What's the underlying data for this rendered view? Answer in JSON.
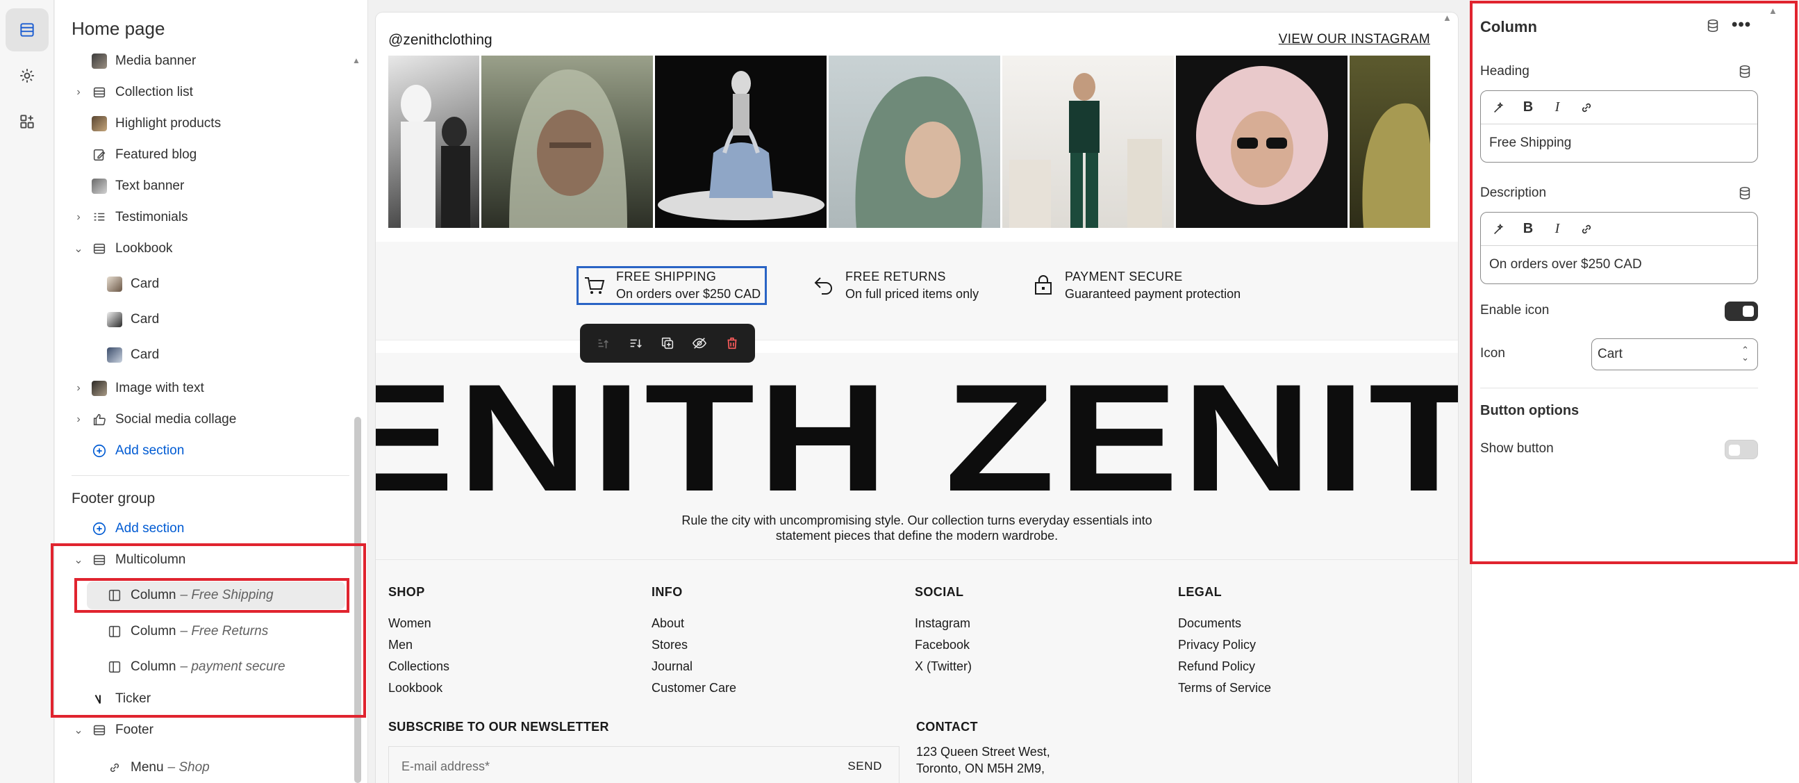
{
  "sidebar": {
    "title": "Home page",
    "items": [
      {
        "label": "Media banner",
        "subtitle": ""
      },
      {
        "label": "Collection list",
        "subtitle": ""
      },
      {
        "label": "Highlight products",
        "subtitle": ""
      },
      {
        "label": "Featured blog",
        "subtitle": ""
      },
      {
        "label": "Text banner",
        "subtitle": ""
      },
      {
        "label": "Testimonials",
        "subtitle": ""
      },
      {
        "label": "Lookbook",
        "subtitle": ""
      },
      {
        "label": "Card",
        "subtitle": ""
      },
      {
        "label": "Card",
        "subtitle": ""
      },
      {
        "label": "Card",
        "subtitle": ""
      },
      {
        "label": "Image with text",
        "subtitle": ""
      },
      {
        "label": "Social media collage",
        "subtitle": ""
      }
    ],
    "add_section_label": "Add section",
    "footer_group_label": "Footer group",
    "footer_items": [
      {
        "label": "Multicolumn",
        "subtitle": ""
      },
      {
        "label": "Column",
        "subtitle": "– Free Shipping"
      },
      {
        "label": "Column",
        "subtitle": "– Free Returns"
      },
      {
        "label": "Column",
        "subtitle": "– payment secure"
      },
      {
        "label": "Ticker",
        "subtitle": ""
      },
      {
        "label": "Footer",
        "subtitle": ""
      },
      {
        "label": "Menu",
        "subtitle": "– Shop"
      }
    ]
  },
  "preview": {
    "instagram_handle": "@zenithclothing",
    "instagram_link": "VIEW OUR INSTAGRAM",
    "features": [
      {
        "title": "FREE SHIPPING",
        "desc": "On orders over $250 CAD",
        "icon": "cart-icon"
      },
      {
        "title": "FREE RETURNS",
        "desc": "On full priced items only",
        "icon": "return-arrow-icon"
      },
      {
        "title": "PAYMENT SECURE",
        "desc": "Guaranteed payment protection",
        "icon": "lock-icon"
      }
    ],
    "ticker_text": "ENITH  ZENITH",
    "tagline_line1": "Rule the city with uncompromising style. Our collection turns everyday essentials into",
    "tagline_line2": "statement pieces that define the modern wardrobe.",
    "footer_columns": [
      {
        "title": "SHOP",
        "links": [
          "Women",
          "Men",
          "Collections",
          "Lookbook"
        ]
      },
      {
        "title": "INFO",
        "links": [
          "About",
          "Stores",
          "Journal",
          "Customer Care"
        ]
      },
      {
        "title": "SOCIAL",
        "links": [
          "Instagram",
          "Facebook",
          "X (Twitter)"
        ]
      },
      {
        "title": "LEGAL",
        "links": [
          "Documents",
          "Privacy Policy",
          "Refund Policy",
          "Terms of Service"
        ]
      }
    ],
    "newsletter_title": "SUBSCRIBE TO OUR NEWSLETTER",
    "newsletter_placeholder": "E-mail address*",
    "newsletter_send": "SEND",
    "contact_title": "CONTACT",
    "contact_address": "123 Queen Street West,\nToronto, ON M5H 2M9,"
  },
  "panel": {
    "title": "Column",
    "heading_label": "Heading",
    "heading_value": "Free Shipping",
    "description_label": "Description",
    "description_value": "On orders over $250 CAD",
    "enable_icon_label": "Enable icon",
    "enable_icon_on": true,
    "icon_label": "Icon",
    "icon_value": "Cart",
    "button_options_label": "Button options",
    "show_button_label": "Show button",
    "show_button_on": false
  },
  "colors": {
    "accent_link": "#005bd3",
    "highlight_red": "#e0242f",
    "selection_blue": "#2a64c5"
  }
}
